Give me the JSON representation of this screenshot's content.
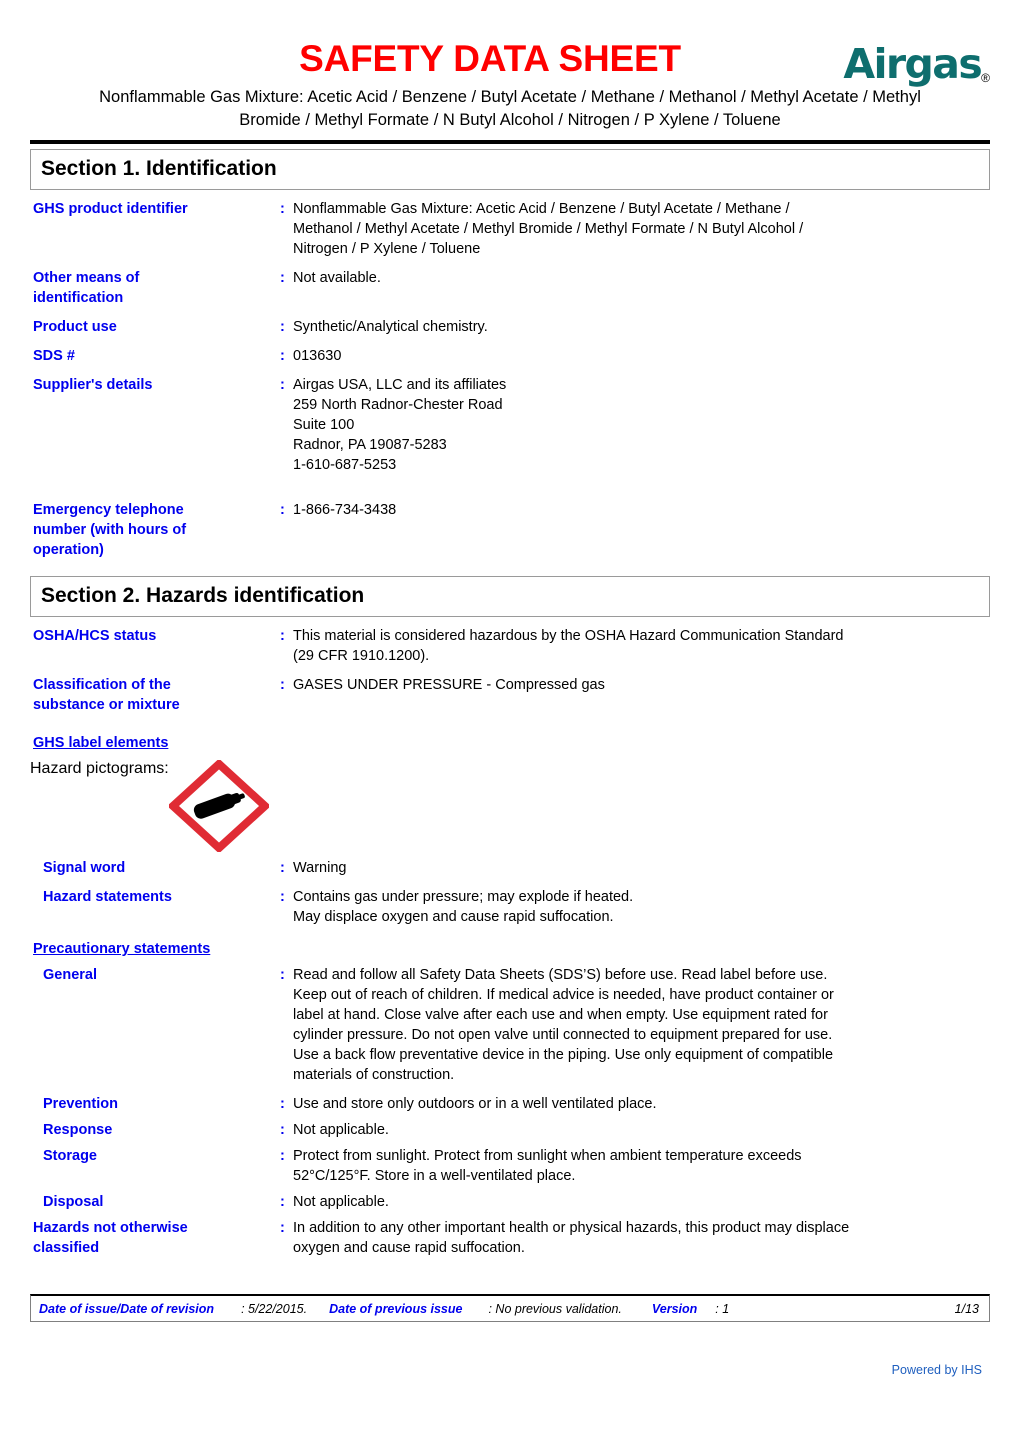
{
  "header": {
    "title": "SAFETY DATA SHEET",
    "brand": "Airgas",
    "brand_reg": "®",
    "subtitle": "Nonflammable Gas Mixture:  Acetic Acid / Benzene / Butyl Acetate / Methane / Methanol / Methyl Acetate / Methyl Bromide / Methyl Formate / N Butyl Alcohol / Nitrogen / P Xylene / Toluene",
    "title_color": "#FF0000",
    "brand_color": "#0E6E6E"
  },
  "section1": {
    "heading": "Section 1. Identification",
    "rows": [
      {
        "label": "GHS product identifier",
        "value": "Nonflammable Gas Mixture:  Acetic Acid / Benzene / Butyl Acetate / Methane /\nMethanol / Methyl Acetate / Methyl Bromide / Methyl Formate / N Butyl Alcohol /\nNitrogen / P Xylene / Toluene"
      },
      {
        "label": "Other means of\nidentification",
        "value": "Not available."
      },
      {
        "label": "Product use",
        "value": "Synthetic/Analytical chemistry."
      },
      {
        "label": "SDS #",
        "value": "013630"
      },
      {
        "label": "Supplier's details",
        "value": "Airgas USA, LLC and its affiliates\n259 North Radnor-Chester Road\nSuite 100\nRadnor, PA 19087-5283\n1-610-687-5253"
      },
      {
        "label": "Emergency telephone\nnumber (with hours of\noperation)",
        "value": "1-866-734-3438"
      }
    ]
  },
  "section2": {
    "heading": "Section 2. Hazards identification",
    "rows_top": [
      {
        "label": "OSHA/HCS status",
        "value": "This material is considered hazardous by the OSHA Hazard Communication Standard\n(29 CFR 1910.1200)."
      },
      {
        "label": "Classification of the\nsubstance or mixture",
        "value": "GASES UNDER PRESSURE - Compressed gas"
      }
    ],
    "ghs_label_elements_heading": "GHS label elements",
    "pictogram_label": "Hazard pictograms",
    "pictogram_name": "gas-cylinder-pictogram",
    "pictogram_border_color": "#E02B34",
    "rows_mid": [
      {
        "label": "Signal word",
        "value": "Warning"
      },
      {
        "label": "Hazard statements",
        "value": "Contains gas under pressure; may explode if heated.\nMay displace oxygen and cause rapid suffocation."
      }
    ],
    "precautionary_heading": "Precautionary statements",
    "rows_precautionary": [
      {
        "label": "General",
        "value": "Read and follow all Safety Data Sheets (SDS’S) before use.  Read label before use.\nKeep out of reach of children.  If medical advice is needed, have product container or\nlabel at hand.  Close valve after each use and when empty.  Use equipment rated for\ncylinder pressure.  Do not open valve until connected to equipment prepared for use.\nUse a back flow preventative device in the piping.  Use only equipment of compatible\nmaterials of construction."
      },
      {
        "label": "Prevention",
        "value": "Use and store only outdoors or in a well ventilated place."
      },
      {
        "label": "Response",
        "value": "Not applicable."
      },
      {
        "label": "Storage",
        "value": "Protect from sunlight.  Protect from sunlight when ambient temperature exceeds\n52°C/125°F.  Store in a well-ventilated place."
      },
      {
        "label": "Disposal",
        "value": "Not applicable."
      }
    ],
    "rows_bottom": [
      {
        "label": "Hazards not otherwise\nclassified",
        "value": "In addition to any other important health or physical hazards, this product may displace\noxygen and cause rapid suffocation."
      }
    ]
  },
  "footer": {
    "issue_label": "Date of issue/Date of revision",
    "issue_value": ": 5/22/2015.",
    "previous_label": "Date of previous issue",
    "previous_value": ": No previous validation.",
    "version_label": "Version",
    "version_value": ": 1",
    "page_number": "1/13",
    "powered_by": "Powered by IHS"
  }
}
